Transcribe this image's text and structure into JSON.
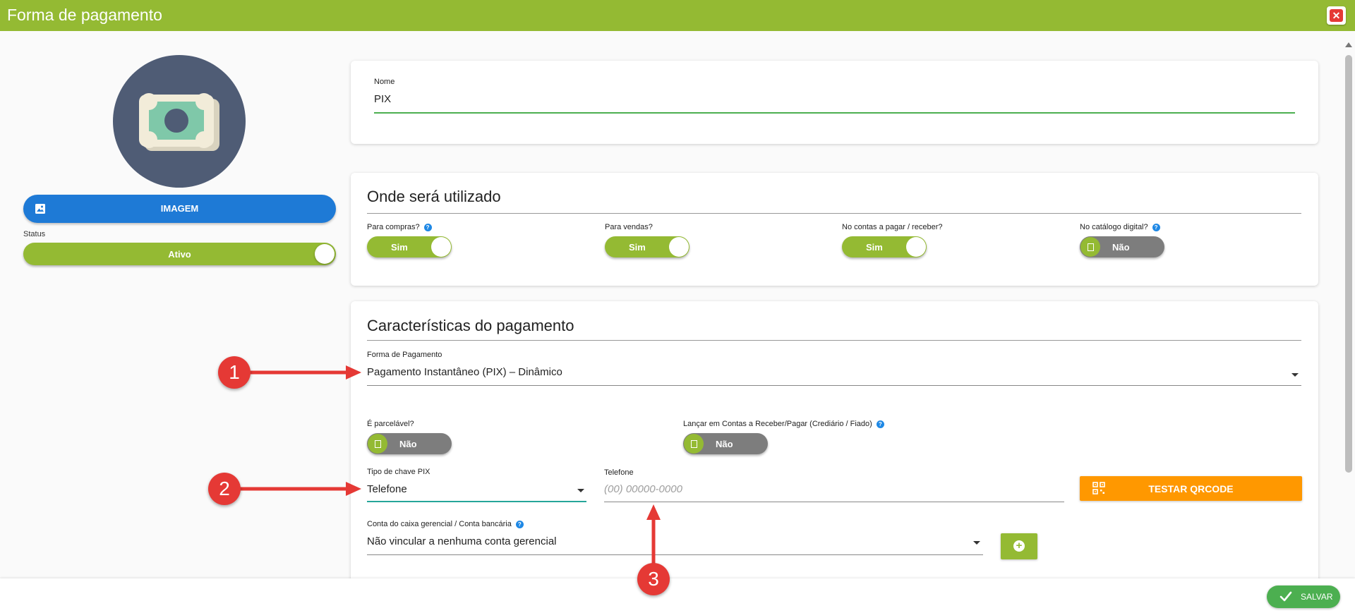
{
  "window": {
    "title": "Forma de pagamento",
    "close_symbol": "✕"
  },
  "colors": {
    "brand_green": "#94ba33",
    "primary_blue": "#1e7ad6",
    "orange": "#ff9800",
    "save_green": "#4caf50",
    "annotation_red": "#e53935"
  },
  "sidebar": {
    "avatar_icon": "money-bills-icon",
    "image_button_label": "IMAGEM",
    "status_label": "Status",
    "status_value": "Ativo"
  },
  "name_field": {
    "label": "Nome",
    "value": "PIX"
  },
  "usage": {
    "title": "Onde será utilizado",
    "options": [
      {
        "label": "Para compras?",
        "value": "Sim",
        "help": true
      },
      {
        "label": "Para vendas?",
        "value": "Sim",
        "help": false
      },
      {
        "label": "No contas a pagar / receber?",
        "value": "Sim",
        "help": false
      },
      {
        "label": "No catálogo digital?",
        "value": "Não",
        "help": true
      }
    ]
  },
  "characteristics": {
    "title": "Características do pagamento",
    "payment_form": {
      "label": "Forma de Pagamento",
      "value": "Pagamento Instantâneo (PIX) – Dinâmico"
    },
    "installments": {
      "label": "É parcelável?",
      "value": "Não"
    },
    "accounts": {
      "label": "Lançar em Contas a Receber/Pagar (Crediário / Fiado)",
      "value": "Não"
    },
    "pix_key_type": {
      "label": "Tipo de chave PIX",
      "value": "Telefone"
    },
    "phone": {
      "label": "Telefone",
      "placeholder": "(00) 00000-0000"
    },
    "test_qr_button": "TESTAR QRCODE",
    "cash_account": {
      "label": "Conta do caixa gerencial / Conta bancária",
      "value": "Não vincular a nenhuma conta gerencial"
    }
  },
  "footer": {
    "save_label": "SALVAR"
  },
  "annotations": [
    "1",
    "2",
    "3"
  ]
}
